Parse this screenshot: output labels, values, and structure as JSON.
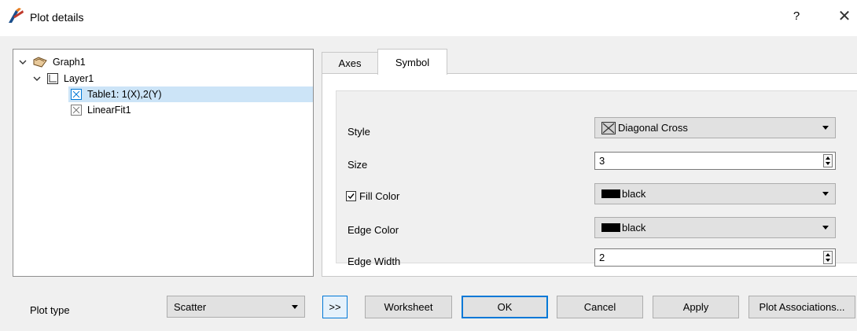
{
  "window": {
    "title": "Plot details",
    "help_label": "?",
    "close_label": "✕"
  },
  "tree": {
    "items": [
      {
        "label": "Graph1",
        "level": 0,
        "expanded": true,
        "icon": "graph-folder-icon"
      },
      {
        "label": "Layer1",
        "level": 1,
        "expanded": true,
        "icon": "layer-icon"
      },
      {
        "label": "Table1: 1(X),2(Y)",
        "level": 2,
        "selected": true,
        "icon": "scatter-plot-icon"
      },
      {
        "label": "LinearFit1",
        "level": 2,
        "selected": false,
        "icon": "scatter-plot-icon"
      }
    ]
  },
  "tabs": [
    {
      "label": "Axes",
      "active": false
    },
    {
      "label": "Symbol",
      "active": true
    }
  ],
  "symbol": {
    "style_label": "Style",
    "style_value": "Diagonal Cross",
    "size_label": "Size",
    "size_value": "3",
    "fill_color_label": "Fill Color",
    "fill_color_checked": true,
    "fill_color_value": "black",
    "edge_color_label": "Edge Color",
    "edge_color_value": "black",
    "edge_width_label": "Edge Width",
    "edge_width_value": "2"
  },
  "bottom": {
    "plot_type_label": "Plot type",
    "plot_type_value": "Scatter",
    "expand_button": ">>",
    "worksheet_button": "Worksheet",
    "ok_button": "OK",
    "cancel_button": "Cancel",
    "apply_button": "Apply",
    "plot_associations_button": "Plot Associations..."
  },
  "colors": {
    "accent": "#0078d7",
    "selection": "#cce4f7",
    "dialog_background": "#f0f0f0"
  }
}
